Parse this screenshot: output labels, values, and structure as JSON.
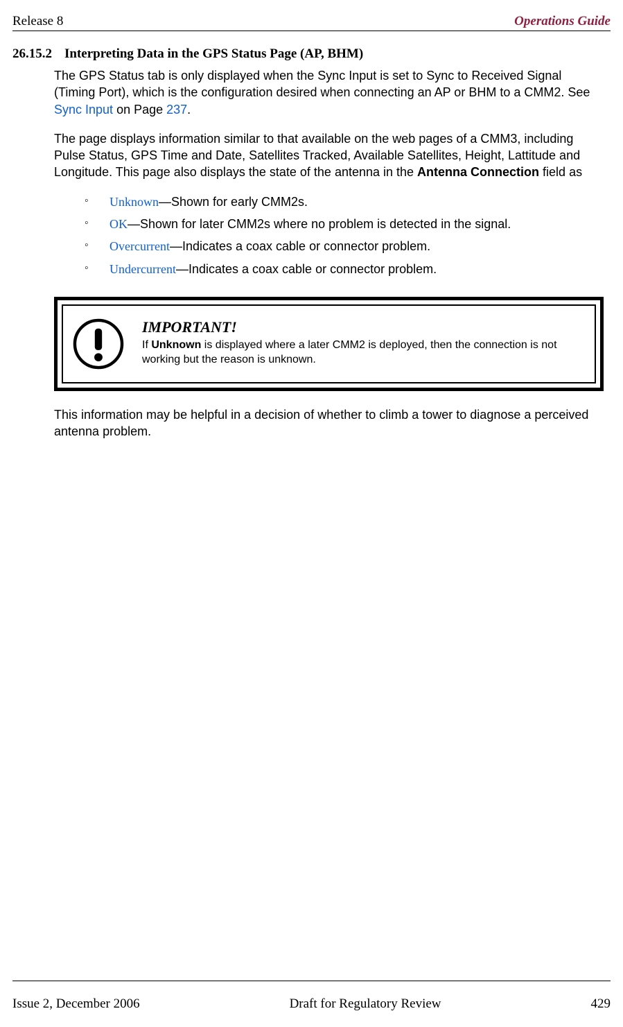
{
  "header": {
    "left": "Release 8",
    "right": "Operations Guide"
  },
  "section": {
    "number": "26.15.2",
    "title": "Interpreting Data in the GPS Status Page (AP, BHM)"
  },
  "para1_a": "The GPS Status tab is only displayed when the Sync Input is set to Sync to Received Signal (Timing Port), which is the configuration desired when connecting an AP or BHM to a CMM2. See ",
  "para1_link": "Sync Input",
  "para1_b": " on Page ",
  "para1_page": "237",
  "para1_c": ".",
  "para2_a": "The page displays information similar to that available on the web pages of a CMM3, including Pulse Status, GPS Time and Date, Satellites Tracked, Available Satellites, Height, Lattitude and Longitude. This page also displays the state of the antenna in the ",
  "para2_bold": "Antenna Connection",
  "para2_b": " field as",
  "defs": [
    {
      "term": "Unknown",
      "desc": "—Shown for early CMM2s."
    },
    {
      "term": "OK",
      "desc": "—Shown for later CMM2s where no problem is detected in the signal."
    },
    {
      "term": "Overcurrent",
      "desc": "—Indicates a coax cable or connector problem."
    },
    {
      "term": "Undercurrent",
      "desc": "—Indicates a coax cable or connector problem."
    }
  ],
  "callout": {
    "title": "IMPORTANT!",
    "body_a": "If ",
    "body_bold": "Unknown",
    "body_b": " is displayed where a later CMM2 is deployed, then the connection is not working but the reason is unknown."
  },
  "para3": "This information may be helpful in a decision of whether to climb a tower to diagnose a perceived antenna problem.",
  "footer": {
    "left": "Issue 2, December 2006",
    "center": "Draft for Regulatory Review",
    "right": "429"
  }
}
